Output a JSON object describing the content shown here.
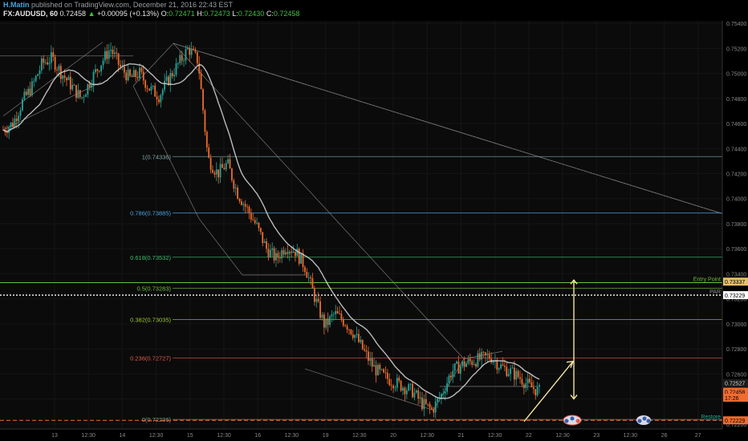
{
  "header": {
    "author": "H.Matin",
    "published": "published on TradingView.com, December 21, 2016 22:43 EST",
    "symbol": "FX:AUDUSD, 60",
    "last": "0.72458",
    "change_arrow": "▲",
    "change": "+0.00095 (+0.13%)",
    "o_label": "O:",
    "o_val": "0.72471",
    "h_label": "H:",
    "h_val": "0.72473",
    "l_label": "L:",
    "l_val": "0.72430",
    "c_label": "C:",
    "c_val": "0.72458"
  },
  "colors": {
    "background": "#0b0b0b",
    "bull": "#26a69a",
    "bear": "#ef6c2e",
    "ma": "#d9d9d9",
    "trendline": "#8a8a8a",
    "target_arrow": "#f5e6a0"
  },
  "chart_data": {
    "type": "candlestick",
    "symbol": "FX:AUDUSD",
    "timeframe": "60",
    "y_ticks": [
      "0.75400",
      "0.75200",
      "0.75000",
      "0.74800",
      "0.74600",
      "0.74400",
      "0.74200",
      "0.74000",
      "0.73800",
      "0.73600",
      "0.73400",
      "0.73200",
      "0.73000",
      "0.72800",
      "0.72600",
      "0.72400",
      "0.72200"
    ],
    "ylim": [
      0.7216,
      0.7542
    ],
    "x_ticks": [
      "13",
      "12:30",
      "14",
      "12:30",
      "15",
      "12:30",
      "16",
      "12:30",
      "19",
      "12:30",
      "20",
      "12:30",
      "21",
      "12:30",
      "22",
      "12:30",
      "23",
      "12:30",
      "26",
      "27"
    ],
    "close_path": [
      0.7455,
      0.746,
      0.7478,
      0.749,
      0.7508,
      0.7512,
      0.75,
      0.749,
      0.748,
      0.7495,
      0.7508,
      0.752,
      0.7505,
      0.7496,
      0.75,
      0.7488,
      0.7482,
      0.7496,
      0.7508,
      0.752,
      0.751,
      0.7432,
      0.742,
      0.7428,
      0.7405,
      0.7392,
      0.7378,
      0.736,
      0.7352,
      0.7362,
      0.7358,
      0.7345,
      0.732,
      0.7298,
      0.7308,
      0.7302,
      0.7292,
      0.7278,
      0.7265,
      0.7258,
      0.7254,
      0.725,
      0.7246,
      0.7236,
      0.7231,
      0.7244,
      0.7262,
      0.7267,
      0.727,
      0.7272,
      0.7274,
      0.7266,
      0.7262,
      0.7257,
      0.725,
      0.7246
    ],
    "fib_levels": [
      {
        "label": "1(0.74336)",
        "value": 0.74336,
        "color": "#7fa6a6"
      },
      {
        "label": "0.786(0.73885)",
        "value": 0.73885,
        "color": "#4aa3df"
      },
      {
        "label": "0.618(0.73532)",
        "value": 0.73532,
        "color": "#3fbf6f"
      },
      {
        "label": "0.5(0.73283)",
        "value": 0.73283,
        "color": "#6fbf3f"
      },
      {
        "label": "0.382(0.73035)",
        "value": 0.73035,
        "color": "#9acd32"
      },
      {
        "label": "0.236(0.72727)",
        "value": 0.72727,
        "color": "#e05a4a"
      },
      {
        "label": "0(0.72236)",
        "value": 0.72236,
        "color": "#8aa0a0"
      }
    ],
    "horizontal_lines": [
      {
        "label": "Entry Point",
        "value": 0.73329,
        "color": "#6fbf3f",
        "style": "solid"
      },
      {
        "label": "PAR",
        "value": 0.73229,
        "color": "#ffffff",
        "style": "dotted"
      },
      {
        "label": "Restore",
        "value": 0.72229,
        "color": "#ef6c2e",
        "style": "dashed"
      }
    ],
    "price_tags": [
      {
        "text": "0.73337",
        "value": 0.73337,
        "bg": "#e6c06a",
        "fg": "#000000"
      },
      {
        "text": "0.73229",
        "value": 0.73229,
        "bg": "#ffffff",
        "fg": "#000000"
      },
      {
        "text": "0.72527",
        "value": 0.72527,
        "bg": "#1c1c1c",
        "fg": "#d0d0d0"
      },
      {
        "text": "0.72458",
        "value": 0.72458,
        "bg": "#ef6c2e",
        "fg": "#000000"
      },
      {
        "text": "17:26",
        "value": 0.7241,
        "bg": "#ef6c2e",
        "fg": "#000000"
      },
      {
        "text": "0.72229",
        "value": 0.72229,
        "bg": "#ef6c2e",
        "fg": "#000000"
      }
    ],
    "annotations": [
      {
        "text": "Entry Point",
        "value": 0.73329,
        "color": "#6fbf3f"
      },
      {
        "text": "PAR",
        "value": 0.73229,
        "color": "#888888"
      },
      {
        "text": "Restore",
        "value": 0.72229,
        "color": "#26a69a"
      }
    ]
  }
}
